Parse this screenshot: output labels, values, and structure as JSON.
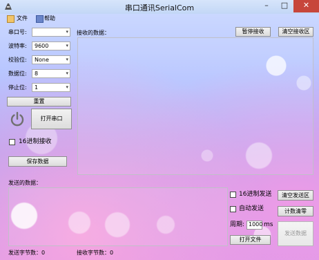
{
  "window": {
    "title": "串口通讯SerialCom",
    "min": "–",
    "max": "□",
    "close": "✕"
  },
  "menu": {
    "file": "文件",
    "help": "帮助"
  },
  "settings": {
    "port_label": "串口号:",
    "port_value": "",
    "baud_label": "波特率:",
    "baud_value": "9600",
    "parity_label": "校验位:",
    "parity_value": "None",
    "databits_label": "数据位:",
    "databits_value": "8",
    "stopbits_label": "停止位:",
    "stopbits_value": "1",
    "reset_button": "重置",
    "open_port_button": "打开串口",
    "hex_receive_label": "16进制接收",
    "save_data_button": "保存数据"
  },
  "receive": {
    "label": "接收的数据：",
    "pause_button": "暂停接收",
    "clear_button": "清空接收区"
  },
  "send": {
    "label": "发送的数据：",
    "hex_send_label": "16进制发送",
    "clear_button": "清空发送区",
    "auto_send_label": "自动发送",
    "reset_count_button": "计数清零",
    "period_label": "周期:",
    "period_value": "1000",
    "period_unit": "ms",
    "open_file_button": "打开文件",
    "send_button": "发送数据"
  },
  "status": {
    "sent_bytes": "发送字节数：0",
    "received_bytes": "接收字节数：0"
  },
  "icons": {
    "app": "app-icon",
    "file": "file-icon",
    "help": "help-icon",
    "power": "power-icon",
    "dropdown": "chevron-down-icon"
  }
}
